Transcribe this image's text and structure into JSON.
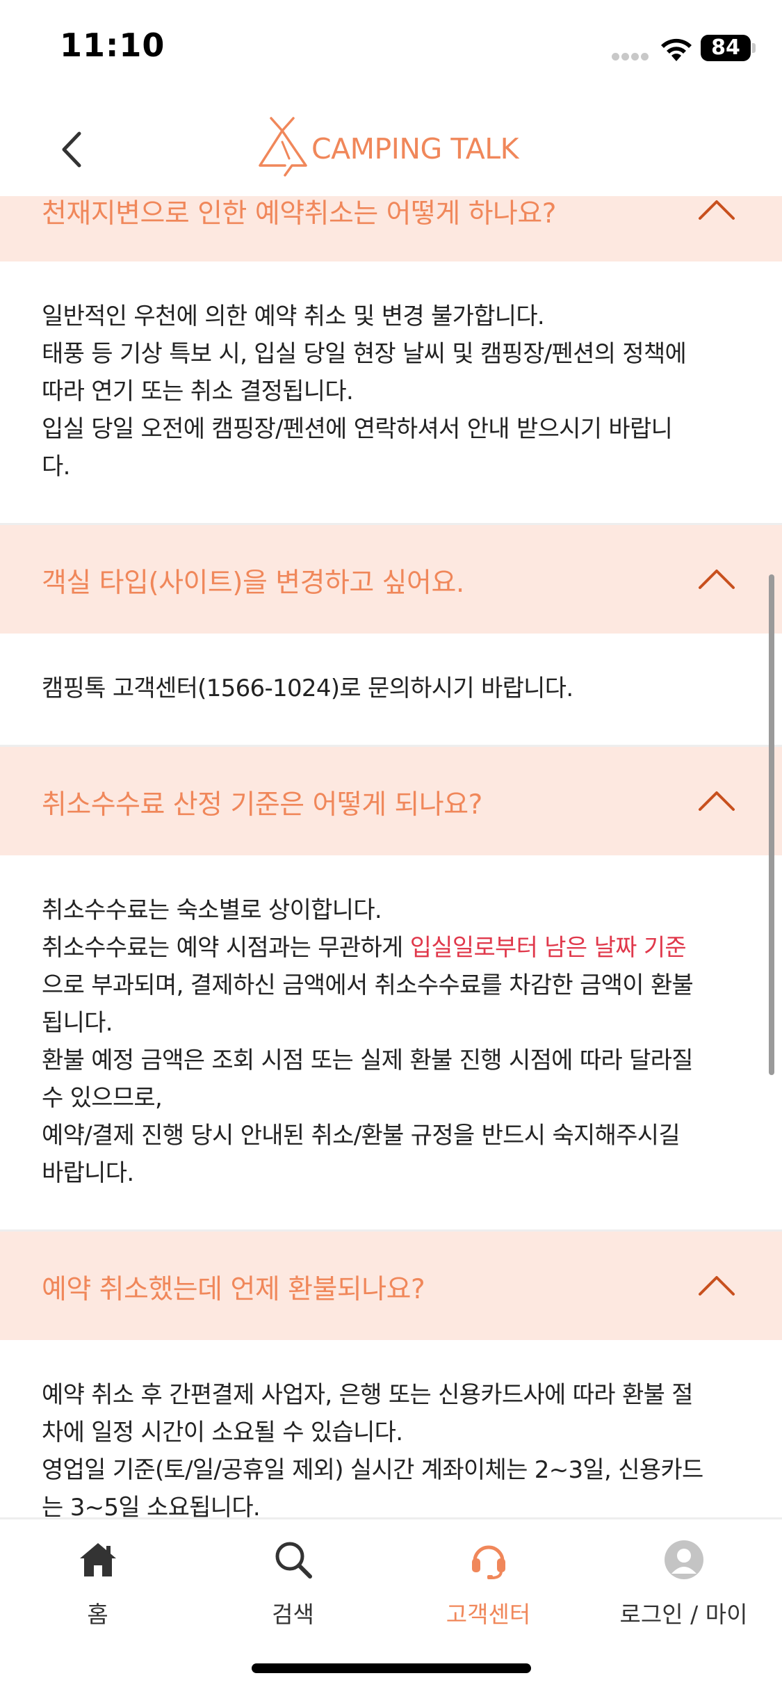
{
  "status_bar": {
    "time": "11:10",
    "battery": "84"
  },
  "header": {
    "logo_text": "CAMPING TALK"
  },
  "faqs": [
    {
      "question": "천재지변으로 인한 예약취소는 어떻게 하나요?",
      "answer_lines": [
        "일반적인 우천에 의한 예약 취소 및 변경 불가합니다.",
        "태풍 등 기상 특보 시, 입실 당일 현장 날씨 및 캠핑장/펜션의 정책에",
        "따라 연기 또는 취소 결정됩니다.",
        "입실 당일 오전에 캠핑장/펜션에 연락하셔서 안내 받으시기 바랍니",
        "다."
      ]
    },
    {
      "question": "객실 타입(사이트)을 변경하고 싶어요.",
      "answer_lines": [
        "캠핑톡 고객센터(1566-1024)로 문의하시기 바랍니다."
      ]
    },
    {
      "question": "취소수수료 산정 기준은 어떻게 되나요?",
      "answer_line_1": "취소수수료는 숙소별로 상이합니다.",
      "answer_line_2_prefix": "취소수수료는 예약 시점과는 무관하게 ",
      "answer_line_2_highlight": "입실일로부터 남은 날짜 기준",
      "answer_line_3": "으로 부과되며, 결제하신 금액에서 취소수수료를 차감한 금액이 환불",
      "answer_line_4": "됩니다.",
      "answer_line_5": "환불 예정 금액은 조회 시점 또는 실제 환불 진행 시점에 따라 달라질",
      "answer_line_6": "수 있으므로,",
      "answer_line_7": "예약/결제 진행 당시 안내된 취소/환불 규정을 반드시 숙지해주시길",
      "answer_line_8": "바랍니다."
    },
    {
      "question": "예약 취소했는데 언제 환불되나요?",
      "answer_lines": [
        "예약 취소 후 간편결제 사업자, 은행 또는 신용카드사에 따라 환불 절",
        "차에 일정 시간이 소요될 수 있습니다.",
        "영업일 기준(토/일/공휴일 제외) 실시간 계좌이체는 2~3일, 신용카드",
        "는 3~5일 소요됩니다."
      ]
    }
  ],
  "tabs": [
    {
      "label": "홈",
      "icon": "home-icon"
    },
    {
      "label": "검색",
      "icon": "search-icon"
    },
    {
      "label": "고객센터",
      "icon": "headset-icon",
      "active": true
    },
    {
      "label": "로그인 / 마이",
      "icon": "profile-icon"
    }
  ],
  "colors": {
    "accent": "#f0875a",
    "question_bg": "#fde8e0",
    "highlight": "#e0384b",
    "chevron": "#c8501e"
  }
}
